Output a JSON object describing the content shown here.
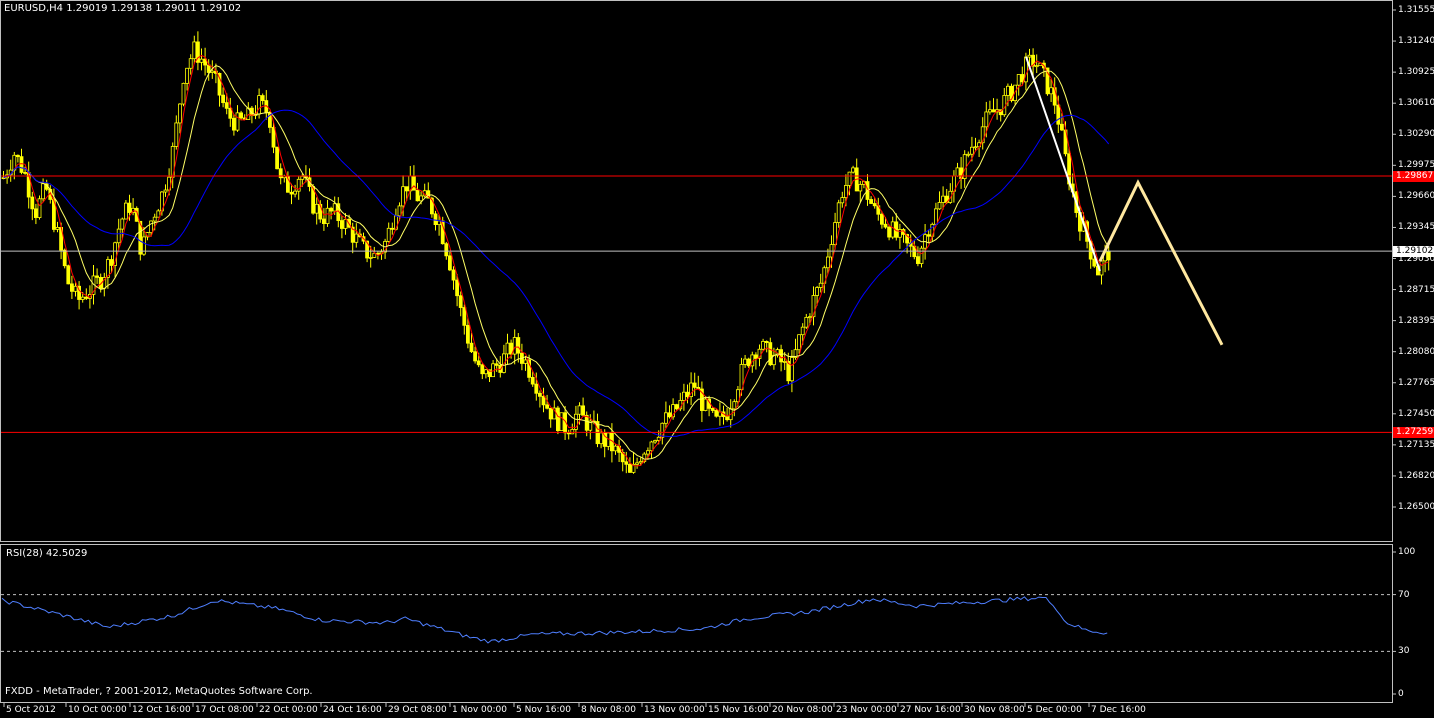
{
  "window": {
    "title": "EURUSD,H4  1.29019 1.29138 1.29011 1.29102",
    "copyright": "FXDD - MetaTrader, ? 2001-2012, MetaQuotes Software Corp."
  },
  "rsi": {
    "title": "RSI(28) 42.5029",
    "levels": [
      "100",
      "70",
      "30",
      "0"
    ],
    "level_values": [
      100,
      70,
      30,
      0
    ]
  },
  "price_axis": {
    "labels": [
      "1.31555",
      "1.31240",
      "1.30925",
      "1.30610",
      "1.30290",
      "1.29975",
      "1.29660",
      "1.29345",
      "1.29030",
      "1.28715",
      "1.28395",
      "1.28080",
      "1.27765",
      "1.27450",
      "1.27135",
      "1.26820",
      "1.26500"
    ],
    "horizontal_lines": [
      {
        "label": "1.29867",
        "price": 1.29867,
        "color": "#ff0000"
      },
      {
        "label": "1.27259",
        "price": 1.27259,
        "color": "#ff0000"
      },
      {
        "label": "1.29102",
        "price": 1.29102,
        "color": "#c0c0c0",
        "current": true
      }
    ]
  },
  "time_axis": {
    "labels": [
      "5 Oct 2012",
      "10 Oct 00:00",
      "12 Oct 16:00",
      "17 Oct 08:00",
      "22 Oct 00:00",
      "24 Oct 16:00",
      "29 Oct 08:00",
      "1 Nov 00:00",
      "5 Nov 16:00",
      "8 Nov 08:00",
      "13 Nov 00:00",
      "15 Nov 16:00",
      "20 Nov 08:00",
      "23 Nov 00:00",
      "27 Nov 16:00",
      "30 Nov 08:00",
      "5 Dec 00:00",
      "7 Dec 16:00"
    ]
  },
  "colors": {
    "background": "#000000",
    "candle_bull": "#ffff00",
    "candle_bear": "#ffff00",
    "ma_fast": "#ff0000",
    "ma_mid": "#ffff66",
    "ma_slow": "#0000ff",
    "rsi_line": "#4f7fff",
    "support_resistance": "#ff0000",
    "projection": "#ffe8a0"
  },
  "chart_data": {
    "type": "candlestick",
    "symbol": "EURUSD",
    "timeframe": "H4",
    "ylim": [
      1.265,
      1.31555
    ],
    "close_path": [
      [
        0,
        1.2985
      ],
      [
        1,
        1.301
      ],
      [
        2,
        1.299
      ],
      [
        3,
        1.295
      ],
      [
        4,
        1.2975
      ],
      [
        5,
        1.293
      ],
      [
        6,
        1.288
      ],
      [
        7,
        1.286
      ],
      [
        8,
        1.287
      ],
      [
        9,
        1.288
      ],
      [
        10,
        1.29
      ],
      [
        11,
        1.294
      ],
      [
        12,
        1.296
      ],
      [
        13,
        1.291
      ],
      [
        14,
        1.2945
      ],
      [
        15,
        1.297
      ],
      [
        16,
        1.3015
      ],
      [
        17,
        1.3095
      ],
      [
        18,
        1.3115
      ],
      [
        19,
        1.31
      ],
      [
        20,
        1.308
      ],
      [
        21,
        1.305
      ],
      [
        22,
        1.304
      ],
      [
        23,
        1.3045
      ],
      [
        24,
        1.306
      ],
      [
        25,
        1.305
      ],
      [
        26,
        1.298
      ],
      [
        27,
        1.2975
      ],
      [
        28,
        1.299
      ],
      [
        29,
        1.296
      ],
      [
        30,
        1.2945
      ],
      [
        31,
        1.295
      ],
      [
        32,
        1.294
      ],
      [
        33,
        1.2925
      ],
      [
        34,
        1.291
      ],
      [
        35,
        1.2905
      ],
      [
        36,
        1.292
      ],
      [
        37,
        1.296
      ],
      [
        38,
        1.298
      ],
      [
        39,
        1.2965
      ],
      [
        40,
        1.296
      ],
      [
        41,
        1.294
      ],
      [
        42,
        1.29
      ],
      [
        43,
        1.285
      ],
      [
        44,
        1.281
      ],
      [
        45,
        1.278
      ],
      [
        46,
        1.279
      ],
      [
        47,
        1.28
      ],
      [
        48,
        1.2815
      ],
      [
        49,
        1.28
      ],
      [
        50,
        1.278
      ],
      [
        51,
        1.2755
      ],
      [
        52,
        1.274
      ],
      [
        53,
        1.273
      ],
      [
        54,
        1.2745
      ],
      [
        55,
        1.2735
      ],
      [
        56,
        1.272
      ],
      [
        57,
        1.2715
      ],
      [
        58,
        1.27
      ],
      [
        59,
        1.268
      ],
      [
        60,
        1.2705
      ],
      [
        61,
        1.272
      ],
      [
        62,
        1.2735
      ],
      [
        63,
        1.2745
      ],
      [
        64,
        1.276
      ],
      [
        65,
        1.2775
      ],
      [
        66,
        1.275
      ],
      [
        67,
        1.2735
      ],
      [
        68,
        1.2745
      ],
      [
        69,
        1.2775
      ],
      [
        70,
        1.28
      ],
      [
        71,
        1.2815
      ],
      [
        72,
        1.2805
      ],
      [
        73,
        1.28
      ],
      [
        74,
        1.2785
      ],
      [
        75,
        1.2825
      ],
      [
        76,
        1.2855
      ],
      [
        77,
        1.288
      ],
      [
        78,
        1.293
      ],
      [
        79,
        1.2975
      ],
      [
        80,
        1.2985
      ],
      [
        81,
        1.2975
      ],
      [
        82,
        1.295
      ],
      [
        83,
        1.294
      ],
      [
        84,
        1.2925
      ],
      [
        85,
        1.2915
      ],
      [
        86,
        1.2905
      ],
      [
        87,
        1.2935
      ],
      [
        88,
        1.2955
      ],
      [
        89,
        1.2975
      ],
      [
        90,
        1.299
      ],
      [
        91,
        1.3015
      ],
      [
        92,
        1.3035
      ],
      [
        93,
        1.305
      ],
      [
        94,
        1.306
      ],
      [
        95,
        1.3075
      ],
      [
        96,
        1.3095
      ],
      [
        97,
        1.3105
      ],
      [
        98,
        1.3085
      ],
      [
        99,
        1.306
      ],
      [
        100,
        1.3
      ],
      [
        101,
        1.295
      ],
      [
        102,
        1.292
      ],
      [
        103,
        1.289
      ],
      [
        104,
        1.291
      ]
    ],
    "rsi_path": [
      [
        0,
        66
      ],
      [
        6,
        55
      ],
      [
        10,
        47
      ],
      [
        16,
        55
      ],
      [
        20,
        66
      ],
      [
        26,
        60
      ],
      [
        30,
        52
      ],
      [
        36,
        50
      ],
      [
        38,
        53
      ],
      [
        44,
        40
      ],
      [
        46,
        37
      ],
      [
        50,
        42
      ],
      [
        56,
        43
      ],
      [
        60,
        44
      ],
      [
        66,
        46
      ],
      [
        70,
        53
      ],
      [
        76,
        58
      ],
      [
        82,
        67
      ],
      [
        86,
        62
      ],
      [
        90,
        64
      ],
      [
        96,
        67
      ],
      [
        98,
        68
      ],
      [
        99,
        63
      ],
      [
        100,
        51
      ],
      [
        102,
        45
      ],
      [
        104,
        43
      ]
    ],
    "projection": [
      [
        1.2905,
        1.29
      ],
      [
        1.2976,
        1.298
      ],
      [
        1.2815,
        1.2815
      ]
    ]
  }
}
